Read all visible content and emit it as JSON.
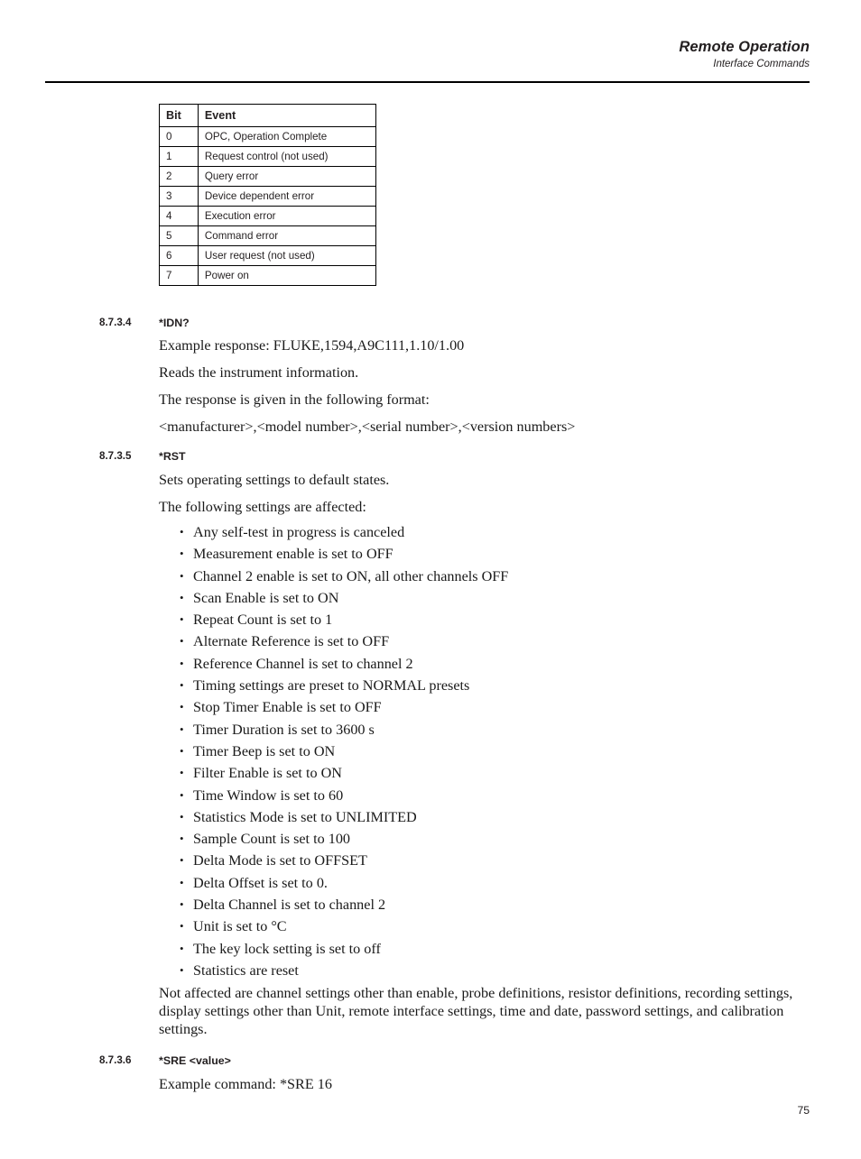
{
  "header": {
    "title": "Remote Operation",
    "subtitle": "Interface Commands"
  },
  "bit_table": {
    "columns": [
      "Bit",
      "Event"
    ],
    "rows": [
      [
        "0",
        "OPC, Operation Complete"
      ],
      [
        "1",
        "Request control (not used)"
      ],
      [
        "2",
        "Query error"
      ],
      [
        "3",
        "Device dependent error"
      ],
      [
        "4",
        "Execution error"
      ],
      [
        "5",
        "Command error"
      ],
      [
        "6",
        "User request (not used)"
      ],
      [
        "7",
        "Power on"
      ]
    ]
  },
  "sections": [
    {
      "number": "8.7.3.4",
      "title": "*IDN?",
      "lines": [
        "Example response: FLUKE,1594,A9C111,1.10/1.00",
        "Reads the instrument information.",
        "The response is given in the following format:",
        "<manufacturer>,<model number>,<serial number>,<version numbers>"
      ]
    },
    {
      "number": "8.7.3.5",
      "title": "*RST",
      "lines": [
        "Sets operating settings to default states.",
        "The following settings are affected:"
      ],
      "bullets": [
        "Any self-test in progress is canceled",
        "Measurement enable is set to OFF",
        "Channel 2 enable is set to ON, all other channels OFF",
        "Scan Enable is set to ON",
        "Repeat Count is set to 1",
        "Alternate Reference is set to OFF",
        "Reference Channel is set to channel 2",
        "Timing settings are preset to NORMAL presets",
        "Stop Timer Enable is set to OFF",
        "Timer Duration is set to 3600 s",
        "Timer Beep is set to ON",
        "Filter Enable is set to ON",
        "Time Window is set to 60",
        "Statistics Mode is set to UNLIMITED",
        "Sample Count is set to 100",
        "Delta Mode is set to OFFSET",
        "Delta Offset is set to 0.",
        "Delta Channel is set to channel 2",
        "Unit is set to °C",
        "The key lock setting is set to off",
        "Statistics are reset"
      ],
      "closing_paragraph": "Not affected are channel settings other than enable, probe definitions, resistor definitions, recording settings, display settings other than Unit, remote interface settings, time and date, password settings, and calibration settings."
    },
    {
      "number": "8.7.3.6",
      "title": "*SRE <value>",
      "lines": [
        "Example command: *SRE 16"
      ]
    }
  ],
  "footer": {
    "page_number": "75"
  }
}
